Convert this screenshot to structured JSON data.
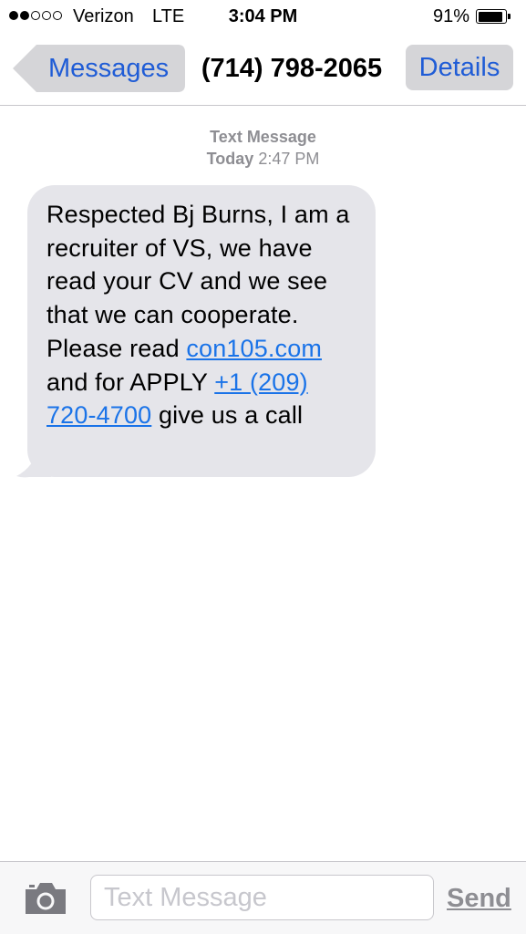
{
  "status_bar": {
    "signal_bars_filled": 2,
    "signal_bars_total": 5,
    "carrier": "Verizon",
    "network": "LTE",
    "time": "3:04 PM",
    "battery_percent_label": "91%",
    "battery_level": 0.91
  },
  "nav": {
    "back_label": "Messages",
    "title": "(714) 798-2065",
    "details_label": "Details",
    "accent_color": "#1f5cd6"
  },
  "conversation": {
    "service_label": "Text Message",
    "day_label": "Today",
    "time_label": "2:47 PM",
    "message": {
      "part1": "Respected Bj Burns, I am a recruiter of VS, we have read your CV and we see that we can cooperate. Please read ",
      "link_url": "con105.com",
      "part2": " and for APPLY ",
      "link_phone": "+1 (209) 720-4700",
      "part3": " give us a call"
    }
  },
  "input_bar": {
    "camera_icon": "camera-icon",
    "placeholder": "Text Message",
    "value": "",
    "send_label": "Send"
  }
}
